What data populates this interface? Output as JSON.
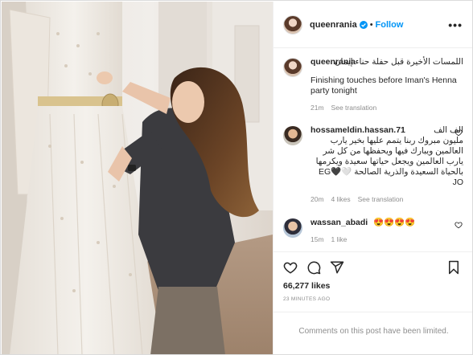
{
  "post": {
    "username": "queenrania",
    "follow_label": "Follow",
    "more_label": "•••"
  },
  "caption": {
    "username": "queenrania",
    "arabic_text": "اللمسات الأخيرة قبل حفلة حناء إيمان",
    "english_text": "Finishing touches before Iman's Henna party tonight",
    "time": "21m",
    "see_translation": "See translation"
  },
  "comments": [
    {
      "username": "hossameldin.hassan.71",
      "arabic_prefix": "الف الف",
      "text": "مليون مبروك ربنا يتمم عليها بخير يارب العالمين ويبارك فيها ويحفظها من كل شر يارب العالمين ويجعل حياتها سعيدة ويكرمها بالحياة السعيدة والذرية الصالحة 🤍EG🖤JO",
      "time": "20m",
      "likes": "4 likes",
      "see_translation": "See translation"
    },
    {
      "username": "wassan_abadi",
      "text": "😍😍😍😍",
      "time": "15m",
      "likes": "1 like"
    }
  ],
  "engagement": {
    "likes": "66,277 likes",
    "timestamp": "23 MINUTES AGO",
    "comments_limited": "Comments on this post have been limited."
  },
  "icons": {
    "verified": "verified-badge-icon",
    "more": "more-options-icon",
    "like": "heart-icon",
    "comment": "comment-icon",
    "share": "share-icon",
    "save": "bookmark-icon"
  },
  "colors": {
    "accent": "#0095f6",
    "muted": "#8e8e8e",
    "text": "#262626",
    "border": "#efefef"
  }
}
